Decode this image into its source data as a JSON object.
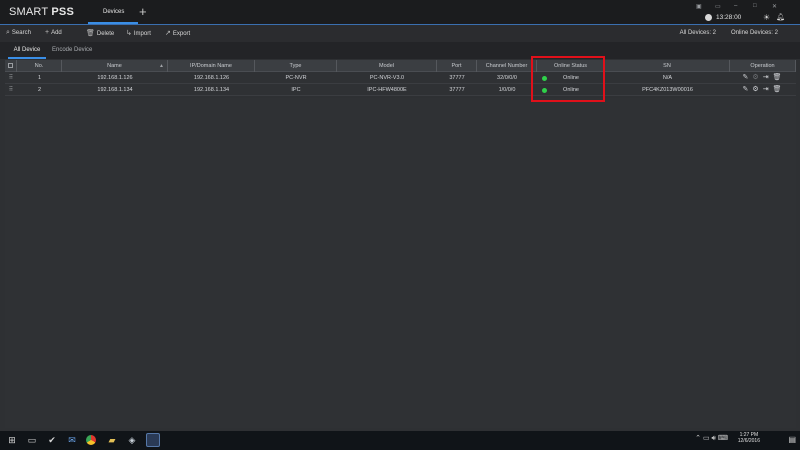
{
  "app": {
    "brand_prefix": "SMART",
    "brand_suffix": "PSS",
    "main_tab": "Devices",
    "add_tab_symbol": "+",
    "clock": "13:28:00",
    "icons": {
      "clock": "clock-icon",
      "theme": "sun-icon",
      "alerts": "bell-icon"
    }
  },
  "toolbar": {
    "search": "Search",
    "add": "Add",
    "delete": "Delete",
    "import": "Import",
    "export": "Export",
    "all_devices_label": "All Devices:",
    "all_devices_count": "2",
    "online_devices_label": "Online Devices:",
    "online_devices_count": "2"
  },
  "subtabs": {
    "all": "All Device",
    "encode": "Encode Device"
  },
  "table": {
    "headers": {
      "no": "No.",
      "name": "Name",
      "ip": "IP/Domain Name",
      "type": "Type",
      "model": "Model",
      "port": "Port",
      "channel": "Channel Number",
      "status": "Online Status",
      "sn": "SN",
      "operation": "Operation"
    },
    "rows": [
      {
        "no": "1",
        "name": "192.168.1.126",
        "ip": "192.168.1.126",
        "type": "PC-NVR",
        "model": "PC-NVR-V3.0",
        "port": "37777",
        "channel": "32/0/0/0",
        "status": "Online",
        "sn": "N/A"
      },
      {
        "no": "2",
        "name": "192.168.1.134",
        "ip": "192.168.1.134",
        "type": "IPC",
        "model": "IPC-HFW4800E",
        "port": "37777",
        "channel": "1/0/0/0",
        "status": "Online",
        "sn": "PFC4KZ013W00016"
      }
    ],
    "status_color": "#2fd14a"
  },
  "annotation": {
    "highlight_color": "#e0101a"
  },
  "taskbar": {
    "time": "1:27 PM",
    "date": "12/6/2016"
  }
}
